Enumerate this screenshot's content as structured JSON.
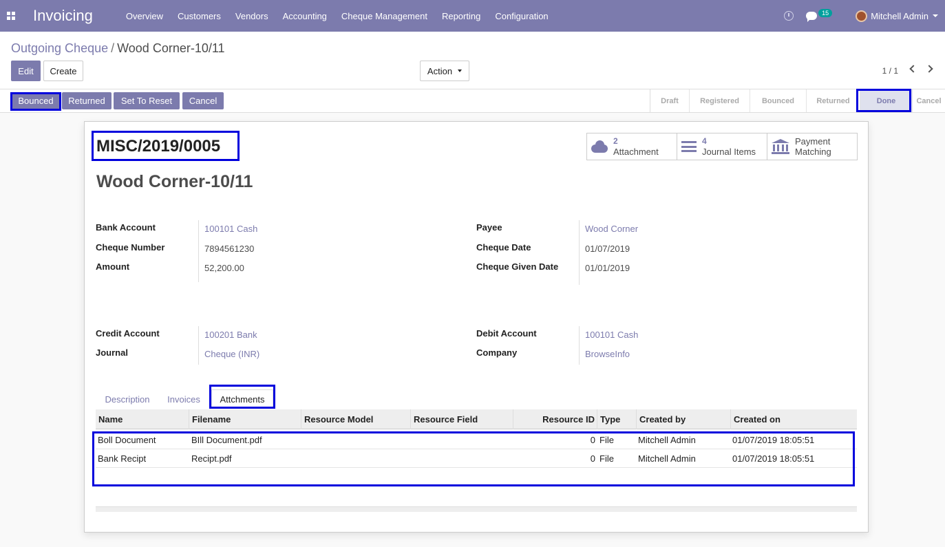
{
  "app": {
    "brand": "Invoicing",
    "menu": [
      "Overview",
      "Customers",
      "Vendors",
      "Accounting",
      "Cheque Management",
      "Reporting",
      "Configuration"
    ],
    "chat_count": "15",
    "user_name": "Mitchell Admin"
  },
  "breadcrumb": {
    "parent": "Outgoing Cheque",
    "separator": "/",
    "current": "Wood Corner-10/11"
  },
  "buttons": {
    "edit": "Edit",
    "create": "Create",
    "action": "Action"
  },
  "pager": {
    "value": "1 / 1"
  },
  "status_buttons": [
    "Bounced",
    "Returned",
    "Set To Reset",
    "Cancel"
  ],
  "stages": [
    "Draft",
    "Registered",
    "Bounced",
    "Returned",
    "Done",
    "Cancel"
  ],
  "active_stage": "Done",
  "record": {
    "reference": "MISC/2019/0005",
    "name": "Wood Corner-10/11"
  },
  "smart_buttons": {
    "attachment": {
      "count": "2",
      "label": "Attachment"
    },
    "journal_items": {
      "count": "4",
      "label": "Journal Items"
    },
    "payment_matching": {
      "line1": "Payment",
      "line2": "Matching"
    }
  },
  "fields": {
    "bank_account": {
      "label": "Bank Account",
      "value": "100101 Cash"
    },
    "cheque_number": {
      "label": "Cheque Number",
      "value": "7894561230"
    },
    "amount": {
      "label": "Amount",
      "value": "52,200.00"
    },
    "payee": {
      "label": "Payee",
      "value": "Wood Corner"
    },
    "cheque_date": {
      "label": "Cheque Date",
      "value": "01/07/2019"
    },
    "cheque_given_date": {
      "label": "Cheque Given Date",
      "value": "01/01/2019"
    },
    "credit_account": {
      "label": "Credit Account",
      "value": "100201 Bank"
    },
    "journal": {
      "label": "Journal",
      "value": "Cheque (INR)"
    },
    "debit_account": {
      "label": "Debit Account",
      "value": "100101 Cash"
    },
    "company": {
      "label": "Company",
      "value": "BrowseInfo"
    }
  },
  "tabs": [
    "Description",
    "Invoices",
    "Attchments"
  ],
  "table": {
    "headers": [
      "Name",
      "Filename",
      "Resource Model",
      "Resource Field",
      "Resource ID",
      "Type",
      "Created by",
      "Created on"
    ],
    "rows": [
      {
        "name": "Boll Document",
        "filename": "BIll Document.pdf",
        "resource_model": "",
        "resource_field": "",
        "resource_id": "0",
        "type": "File",
        "created_by": "Mitchell Admin",
        "created_on": "01/07/2019 18:05:51"
      },
      {
        "name": "Bank Recipt",
        "filename": "Recipt.pdf",
        "resource_model": "",
        "resource_field": "",
        "resource_id": "0",
        "type": "File",
        "created_by": "Mitchell Admin",
        "created_on": "01/07/2019 18:05:51"
      }
    ]
  },
  "colors": {
    "brand": "#7c7bad",
    "highlight": "#0000dd"
  }
}
